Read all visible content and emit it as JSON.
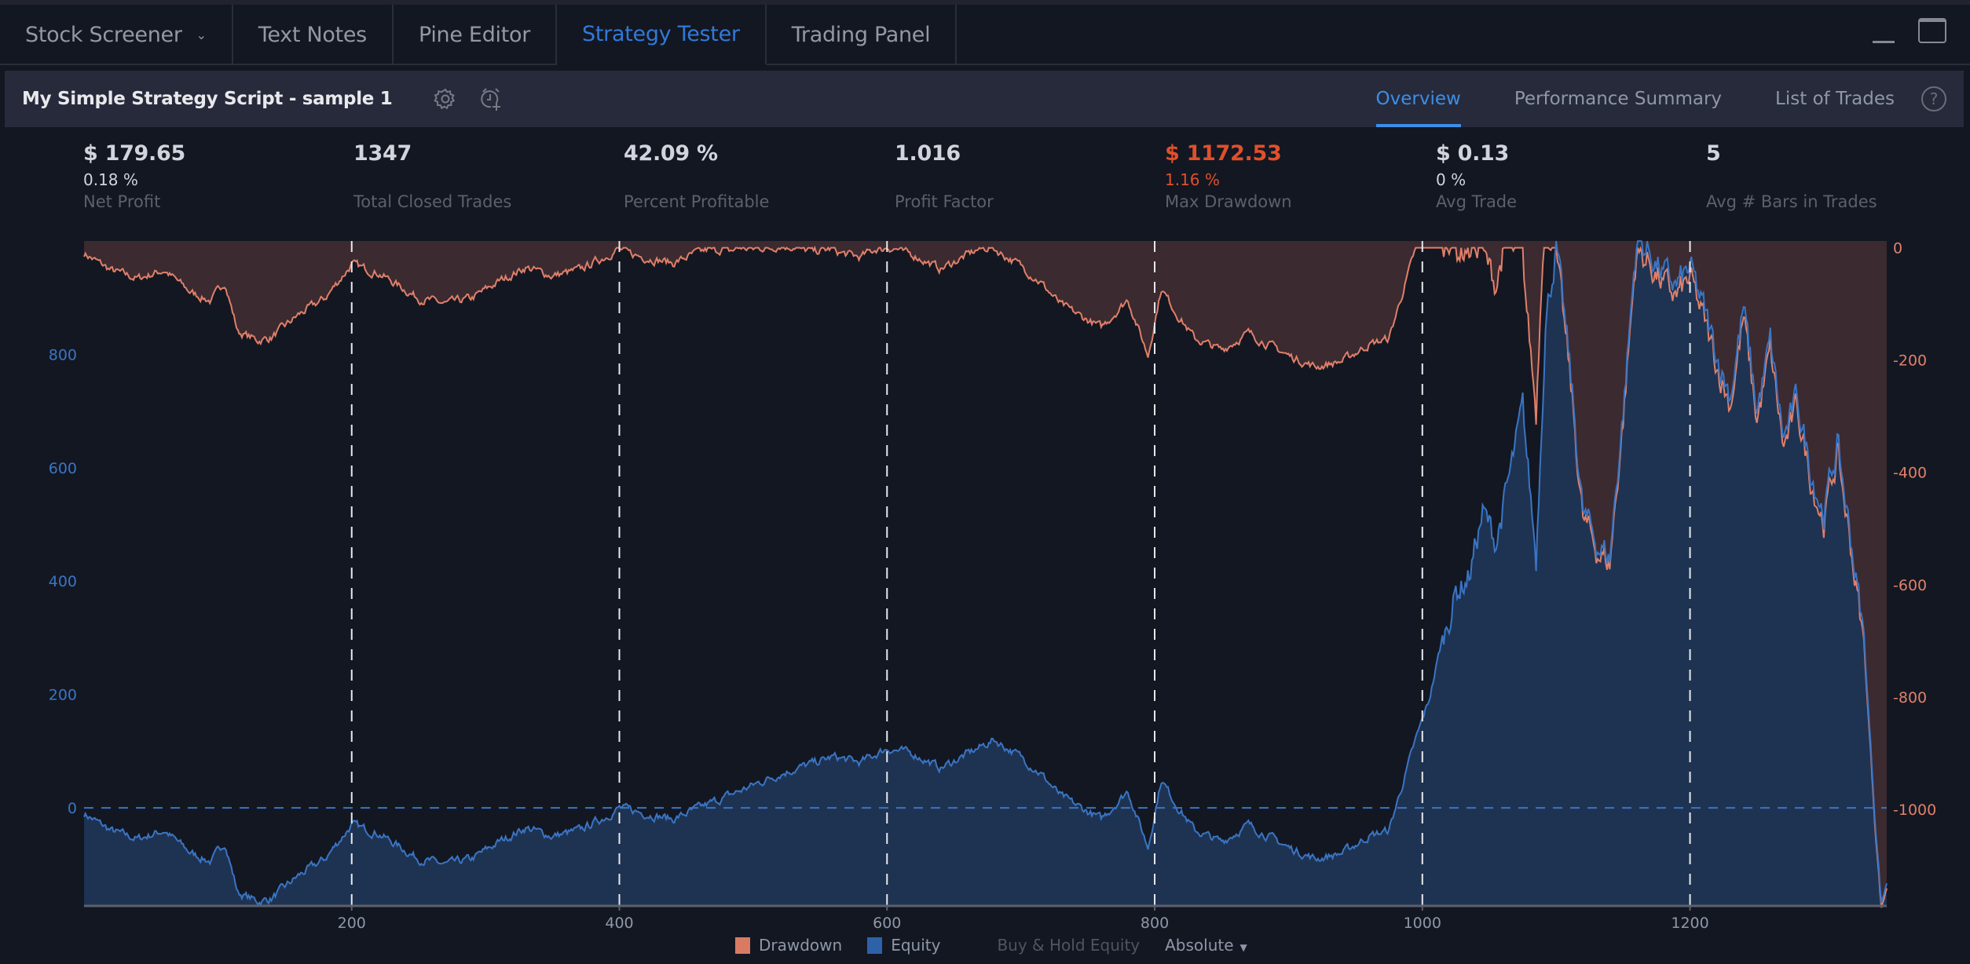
{
  "tabs": [
    {
      "label": "Stock Screener",
      "has_dropdown": true,
      "active": false
    },
    {
      "label": "Text Notes",
      "active": false
    },
    {
      "label": "Pine Editor",
      "active": false
    },
    {
      "label": "Strategy Tester",
      "active": true
    },
    {
      "label": "Trading Panel",
      "active": false
    }
  ],
  "window_controls": {
    "minimize_icon": "minimize-icon",
    "maximize_icon": "maximize-icon"
  },
  "strategy": {
    "title": "My Simple Strategy Script - sample 1",
    "icons": [
      "gear-icon",
      "add-alert-icon"
    ]
  },
  "subtabs": [
    {
      "label": "Overview",
      "active": true
    },
    {
      "label": "Performance Summary",
      "active": false
    },
    {
      "label": "List of Trades",
      "active": false
    }
  ],
  "help_label": "?",
  "stats": [
    {
      "value": "$ 179.65",
      "sub": "0.18 %",
      "label": "Net Profit"
    },
    {
      "value": "1347",
      "sub": "",
      "label": "Total Closed Trades"
    },
    {
      "value": "42.09 %",
      "sub": "",
      "label": "Percent Profitable"
    },
    {
      "value": "1.016",
      "sub": "",
      "label": "Profit Factor"
    },
    {
      "value": "$ 1172.53",
      "sub": "1.16 %",
      "label": "Max Drawdown",
      "negative": true
    },
    {
      "value": "$ 0.13",
      "sub": "0 %",
      "label": "Avg Trade"
    },
    {
      "value": "5",
      "sub": "",
      "label": "Avg # Bars in Trades"
    }
  ],
  "legend": {
    "drawdown": "Drawdown",
    "equity": "Equity",
    "buy_hold": "Buy & Hold Equity",
    "mode": "Absolute"
  },
  "colors": {
    "accent": "#3d8ee6",
    "equity_line": "#3a75c4",
    "equity_fill": "#1e3352",
    "drawdown_line": "#e0806a",
    "drawdown_fill": "#3b2a30",
    "negative": "#e0502a",
    "background": "#131722"
  },
  "chart_data": {
    "type": "area",
    "title": "",
    "xlabel": "",
    "x_ticks": [
      200,
      400,
      600,
      800,
      1000,
      1200
    ],
    "xlim": [
      0,
      1347
    ],
    "left_axis": {
      "label": "Equity",
      "ticks": [
        0,
        200,
        400,
        600,
        800
      ],
      "range": [
        -173,
        1000
      ]
    },
    "right_axis": {
      "label": "Drawdown",
      "ticks": [
        0,
        -200,
        -400,
        -600,
        -800,
        -1000
      ],
      "range": [
        -1172,
        12
      ]
    },
    "zero_line": 0,
    "vertical_markers": [
      200,
      400,
      600,
      800,
      1000,
      1200
    ],
    "series": [
      {
        "name": "Equity",
        "axis": "left",
        "x": [
          0,
          20,
          40,
          60,
          80,
          95,
          105,
          115,
          130,
          140,
          160,
          180,
          200,
          220,
          250,
          270,
          290,
          310,
          330,
          350,
          370,
          390,
          400,
          420,
          440,
          460,
          480,
          500,
          520,
          540,
          560,
          580,
          600,
          620,
          640,
          660,
          680,
          700,
          715,
          730,
          760,
          780,
          795,
          805,
          815,
          830,
          850,
          870,
          900,
          920,
          940,
          960,
          975,
          985,
          995,
          1005,
          1015,
          1025,
          1035,
          1045,
          1055,
          1065,
          1075,
          1085,
          1092,
          1100,
          1110,
          1120,
          1130,
          1140,
          1150,
          1160,
          1170,
          1180,
          1190,
          1200,
          1210,
          1220,
          1230,
          1240,
          1250,
          1260,
          1270,
          1280,
          1290,
          1300,
          1310,
          1320,
          1330,
          1338,
          1343,
          1347
        ],
        "values": [
          -10,
          -40,
          -55,
          -40,
          -80,
          -95,
          -60,
          -150,
          -165,
          -160,
          -120,
          -90,
          -30,
          -45,
          -90,
          -100,
          -90,
          -60,
          -35,
          -50,
          -40,
          -15,
          0,
          -10,
          -20,
          0,
          20,
          40,
          60,
          75,
          90,
          80,
          105,
          95,
          70,
          95,
          120,
          90,
          60,
          20,
          -20,
          30,
          -70,
          50,
          10,
          -40,
          -60,
          -30,
          -70,
          -90,
          -80,
          -50,
          -40,
          40,
          120,
          190,
          300,
          380,
          410,
          520,
          470,
          580,
          700,
          440,
          860,
          990,
          780,
          520,
          470,
          440,
          700,
          1000,
          980,
          940,
          920,
          950,
          880,
          800,
          730,
          880,
          700,
          820,
          650,
          720,
          600,
          520,
          640,
          480,
          300,
          -10,
          -170,
          -130
        ]
      },
      {
        "name": "Drawdown",
        "axis": "right",
        "derived_from": "Equity minus running maximum",
        "min": -1172.53
      }
    ],
    "legend": [
      "Drawdown",
      "Equity",
      "Buy & Hold Equity"
    ],
    "legend_position": "bottom-center"
  }
}
